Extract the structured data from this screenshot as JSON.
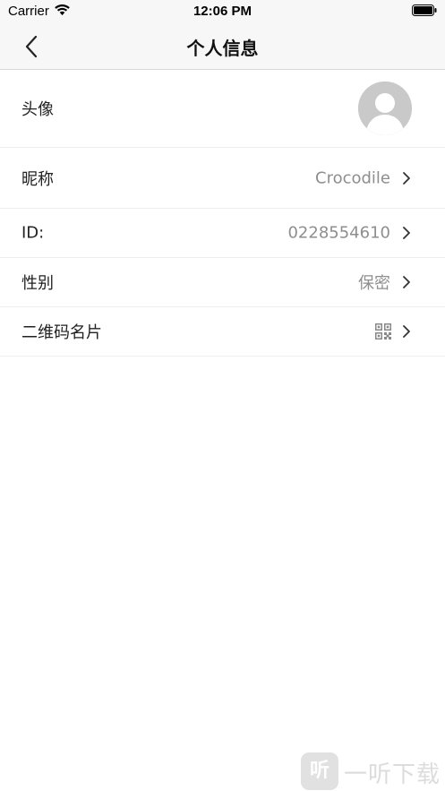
{
  "status_bar": {
    "carrier": "Carrier",
    "time": "12:06 PM"
  },
  "nav": {
    "title": "个人信息"
  },
  "rows": {
    "avatar": {
      "label": "头像"
    },
    "nickname": {
      "label": "昵称",
      "value": "Crocodile"
    },
    "id": {
      "label": "ID:",
      "value": "0228554610"
    },
    "gender": {
      "label": "性别",
      "value": "保密"
    },
    "qrcode": {
      "label": "二维码名片"
    }
  },
  "watermark": {
    "badge": "听",
    "text": "一听下载"
  },
  "colors": {
    "nav_background": "#f7f7f7",
    "label_text": "#222222",
    "value_text": "#8e8e8e",
    "divider": "#eeeeee",
    "avatar_placeholder": "#c9c9c9"
  },
  "icons": {
    "wifi": "wifi-icon",
    "battery": "battery-icon",
    "back": "chevron-left-icon",
    "disclosure": "chevron-right-icon",
    "qr": "qr-code-icon",
    "avatar": "default-avatar-icon"
  }
}
